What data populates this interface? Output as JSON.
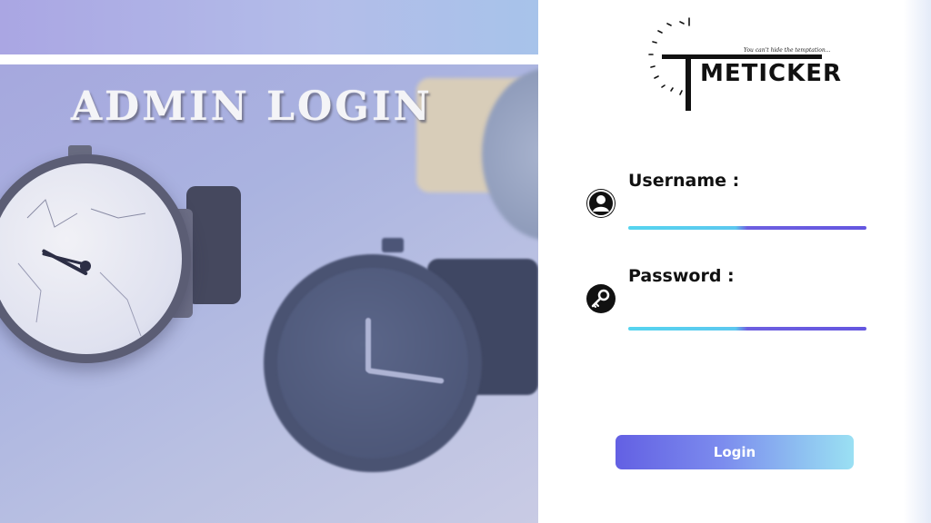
{
  "hero": {
    "title": "ADMIN LOGIN"
  },
  "brand": {
    "name": "METICKER",
    "tagline": "You can't hide the temptation..."
  },
  "form": {
    "username_label": "Username :",
    "username_value": "",
    "password_label": "Password :",
    "password_value": "",
    "login_label": "Login"
  },
  "icons": {
    "username": "user-icon",
    "password": "key-icon"
  },
  "colors": {
    "accent_start": "#55d4ef",
    "accent_end": "#6456e0",
    "button_start": "#6360e3",
    "button_end": "#9ae0f3"
  }
}
